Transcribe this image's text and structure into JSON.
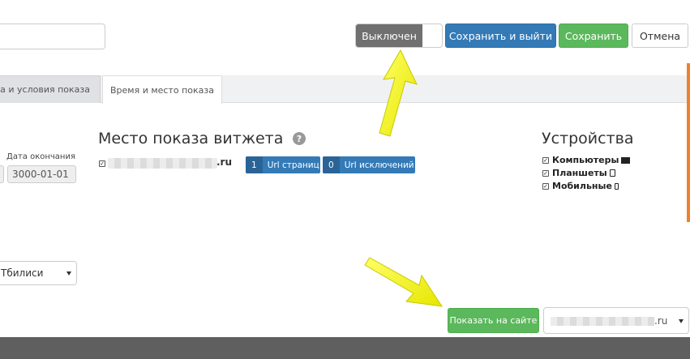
{
  "toolbar": {
    "status_toggle_label": "Выключен",
    "save_exit_label": "Сохранить и выйти",
    "save_label": "Сохранить",
    "cancel_label": "Отмена"
  },
  "tabs": [
    {
      "label": "та и условия показа"
    },
    {
      "label": "Время и место показа"
    }
  ],
  "date": {
    "end_label": "Дата окончания",
    "end_value": "3000-01-01"
  },
  "place": {
    "title": "Место показа витжета",
    "help": "?",
    "site_suffix": ".ru",
    "url_pages_count": "1",
    "url_pages_label": "Url страниц",
    "url_exclusions_count": "0",
    "url_exclusions_label": "Url исключений"
  },
  "devices": {
    "title": "Устройства",
    "items": [
      {
        "label": "Компьютеры",
        "icon": "monitor-icon"
      },
      {
        "label": "Планшеты",
        "icon": "tablet-icon"
      },
      {
        "label": "Мобильные",
        "icon": "phone-icon"
      }
    ]
  },
  "timezone": {
    "value": "Тбилиси"
  },
  "actions": {
    "show_on_site_label": "Показать на сайте",
    "site_select_suffix": ".ru"
  },
  "colors": {
    "primary": "#337ab7",
    "success": "#5cb85c",
    "toggle_off": "#707070",
    "accent_strip": "#f0812a",
    "annotation_arrow": "#ffff00",
    "footer": "#5f5f5f"
  }
}
